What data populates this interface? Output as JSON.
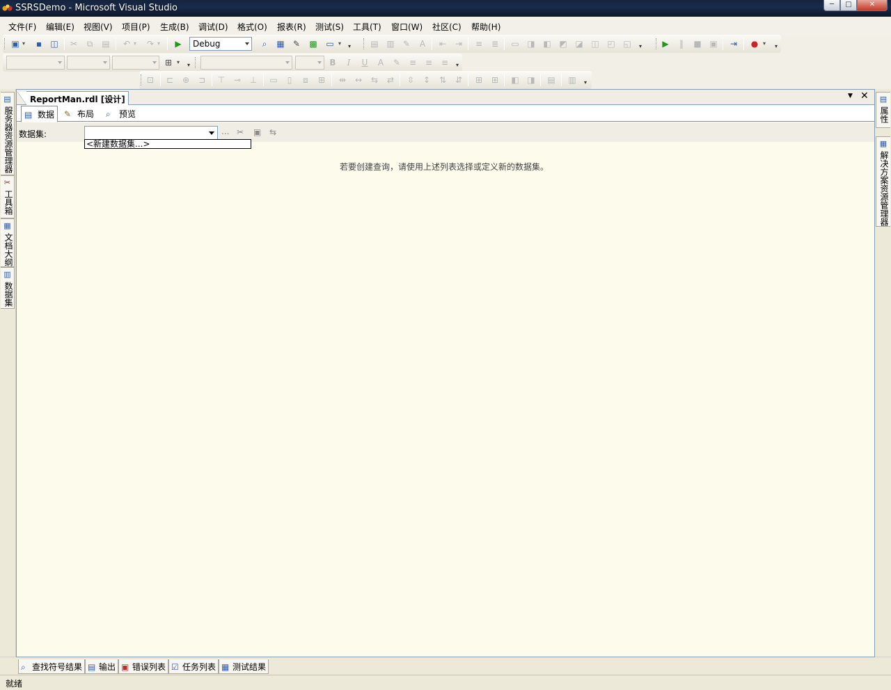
{
  "window": {
    "title": "SSRSDemo - Microsoft Visual Studio",
    "min_glyph": "─",
    "max_glyph": "□",
    "close_glyph": "✕"
  },
  "menubar": {
    "items": [
      {
        "label": "文件(F)"
      },
      {
        "label": "编辑(E)"
      },
      {
        "label": "视图(V)"
      },
      {
        "label": "项目(P)"
      },
      {
        "label": "生成(B)"
      },
      {
        "label": "调试(D)"
      },
      {
        "label": "格式(O)"
      },
      {
        "label": "报表(R)"
      },
      {
        "label": "测试(S)"
      },
      {
        "label": "工具(T)"
      },
      {
        "label": "窗口(W)"
      },
      {
        "label": "社区(C)"
      },
      {
        "label": "帮助(H)"
      }
    ]
  },
  "toolbar": {
    "config": "Debug",
    "bold": "B",
    "italic": "I",
    "underline": "U",
    "font_color": "A"
  },
  "left_tabs": [
    {
      "label": "服务器资源管理器",
      "icon": "server-explorer-icon"
    },
    {
      "label": "工具箱",
      "icon": "toolbox-icon"
    },
    {
      "label": "文档大纲",
      "icon": "document-outline-icon"
    },
    {
      "label": "数据集",
      "icon": "datasets-icon"
    }
  ],
  "right_tabs": [
    {
      "label": "属性",
      "icon": "properties-icon"
    },
    {
      "label": "解决方案资源管理器",
      "icon": "solution-explorer-icon"
    }
  ],
  "document": {
    "tab_title": "ReportMan.rdl [设计]",
    "view_tabs": [
      {
        "label": "数据",
        "active": true
      },
      {
        "label": "布局",
        "active": false
      },
      {
        "label": "预览",
        "active": false
      }
    ],
    "dataset_label": "数据集:",
    "dataset_value": "",
    "dataset_option": "<新建数据集...>",
    "ellipsis": "...",
    "hint": "若要创建查询，请使用上述列表选择或定义新的数据集。"
  },
  "bottom_tabs": [
    {
      "label": "查找符号结果"
    },
    {
      "label": "输出"
    },
    {
      "label": "错误列表"
    },
    {
      "label": "任务列表"
    },
    {
      "label": "测试结果"
    }
  ],
  "status": "就绪"
}
